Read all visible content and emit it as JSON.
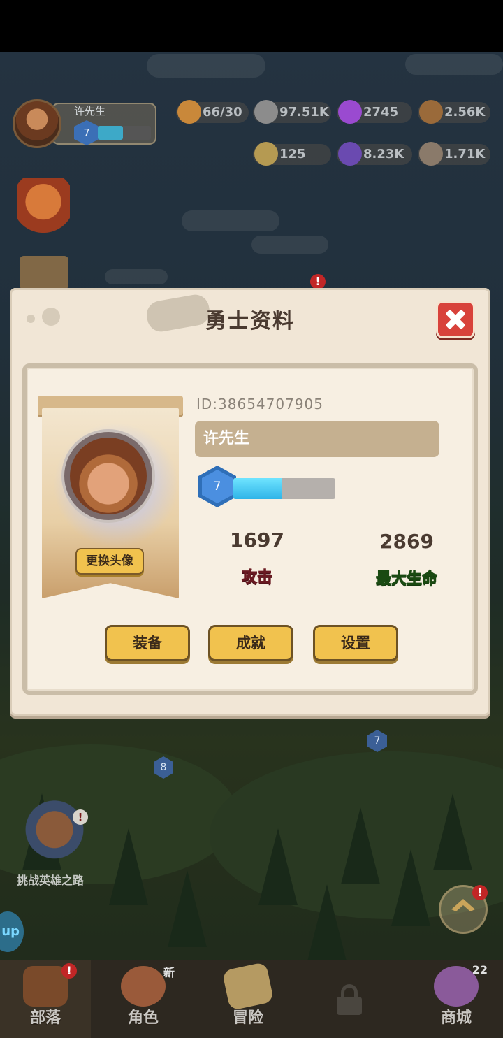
{
  "hud": {
    "player_name": "许先生",
    "level": "7",
    "exp_fraction": 0.48,
    "resources": [
      {
        "icon": "meat-stamina-icon",
        "value": "66/30",
        "color": "#6aa838"
      },
      {
        "icon": "stone-icon",
        "value": "97.51K",
        "color": "#8c8c8c"
      },
      {
        "icon": "purple-gem-icon",
        "value": "2745",
        "color": "#9a4ad0"
      },
      {
        "icon": "wood-log-icon",
        "value": "2.56K",
        "color": "#9a6a3a"
      },
      {
        "icon": "gold-coin-icon",
        "value": "125",
        "color": "#c9a24a"
      },
      {
        "icon": "purple-crystal-icon",
        "value": "8.23K",
        "color": "#6a4ab0"
      },
      {
        "icon": "rock-ore-icon",
        "value": "1.71K",
        "color": "#8a7a6a"
      }
    ]
  },
  "side": {
    "hero_road_label": "挑战英雄之路",
    "up_label": "up",
    "alert_mark": "!",
    "map_badges": [
      "7",
      "8"
    ]
  },
  "modal": {
    "title": "勇士资料",
    "player_id": "ID:38654707905",
    "name": "许先生",
    "level": "7",
    "exp_fraction": 0.47,
    "change_avatar_label": "更换头像",
    "attack_value": "1697",
    "attack_label": "攻击",
    "hp_value": "2869",
    "hp_label": "最大生命",
    "buttons": {
      "equip": "装备",
      "achievement": "成就",
      "settings": "设置"
    }
  },
  "nav": {
    "items": [
      {
        "label": "部落",
        "badge": "!"
      },
      {
        "label": "角色",
        "badge": "新"
      },
      {
        "label": "冒险",
        "badge": ""
      },
      {
        "label": "",
        "badge": ""
      },
      {
        "label": "商城",
        "badge": "22"
      }
    ]
  },
  "colors": {
    "accent_gold": "#f1c24e",
    "close_red": "#d8423b",
    "attack_red": "#e5365a",
    "hp_green": "#58d33a"
  }
}
